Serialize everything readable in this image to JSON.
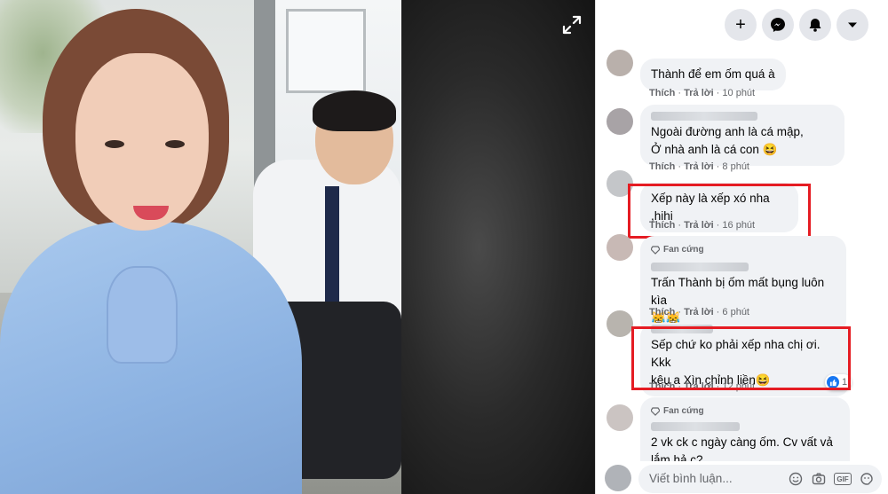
{
  "topbar": {
    "icons": [
      "plus-icon",
      "messenger-icon",
      "bell-icon",
      "caret-down-icon"
    ],
    "plus_glyph": "+"
  },
  "comments": [
    {
      "text_lines": [
        "Thành để em ốm quá à"
      ],
      "like": "Thích",
      "reply": "Trả lời",
      "time": "10 phút"
    },
    {
      "text_lines": [
        "Ngoài đường anh là cá mập,",
        "Ở nhà anh là cá con 😆"
      ],
      "like": "Thích",
      "reply": "Trả lời",
      "time": "8 phút"
    },
    {
      "text_lines": [
        "Xếp này là xếp xó nha ,hihi"
      ],
      "like": "Thích",
      "reply": "Trả lời",
      "time": "16 phút"
    },
    {
      "badge": "Fan cứng",
      "text_lines": [
        "Trấn Thành bị ốm mất bụng luôn kìa",
        "😹😹"
      ],
      "like": "Thích",
      "reply": "Trả lời",
      "time": "6 phút"
    },
    {
      "text_lines": [
        "Sếp chứ ko phải xếp nha chị ơi. Kkk",
        "kêu a Xìn chỉnh liền😆"
      ],
      "like": "Thích",
      "reply": "Trả lời",
      "time": "12 phút",
      "reaction_count": "1"
    },
    {
      "badge": "Fan cứng",
      "text_lines": [
        "2 vk ck c ngày càng ốm. Cv vất vả",
        "lắm hả c?"
      ]
    }
  ],
  "composer": {
    "placeholder": "Viết bình luận...",
    "tools": [
      "emoji-icon",
      "camera-icon",
      "gif-icon",
      "sticker-icon"
    ],
    "gif_label": "GIF"
  },
  "colors": {
    "highlight": "#e51c23",
    "bubble": "#f0f2f5",
    "meta": "#65676b",
    "like_blue": "#1877f2"
  }
}
